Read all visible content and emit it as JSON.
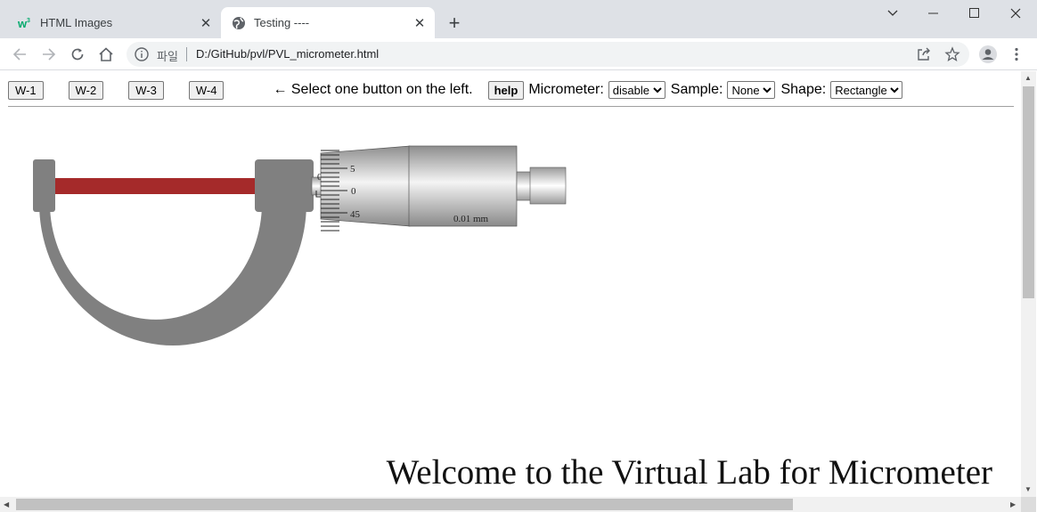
{
  "browser": {
    "tabs": [
      {
        "title": "HTML Images",
        "active": false,
        "favicon": "w3schools-logo-icon"
      },
      {
        "title": "Testing ----",
        "active": true,
        "favicon": "globe-icon"
      }
    ],
    "address": {
      "label": "파일",
      "url": "D:/GitHub/pvl/PVL_micrometer.html"
    }
  },
  "page": {
    "buttons": [
      "W-1",
      "W-2",
      "W-3",
      "W-4"
    ],
    "hint": "← Select one button on the left.",
    "help_label": "help",
    "micrometer_label": "Micrometer:",
    "micrometer_value": "disable",
    "sample_label": "Sample:",
    "sample_value": "None",
    "shape_label": "Shape:",
    "shape_value": "Rectangle",
    "thimble_scale": [
      "5",
      "0",
      "45"
    ],
    "sleeve_mark": "0",
    "resolution_label": "0.01 mm",
    "welcome": "Welcome to the Virtual Lab for Micrometer"
  },
  "colors": {
    "frame": "#808080",
    "spindle": "#a52a2a",
    "tab_strip": "#dee1e6"
  }
}
